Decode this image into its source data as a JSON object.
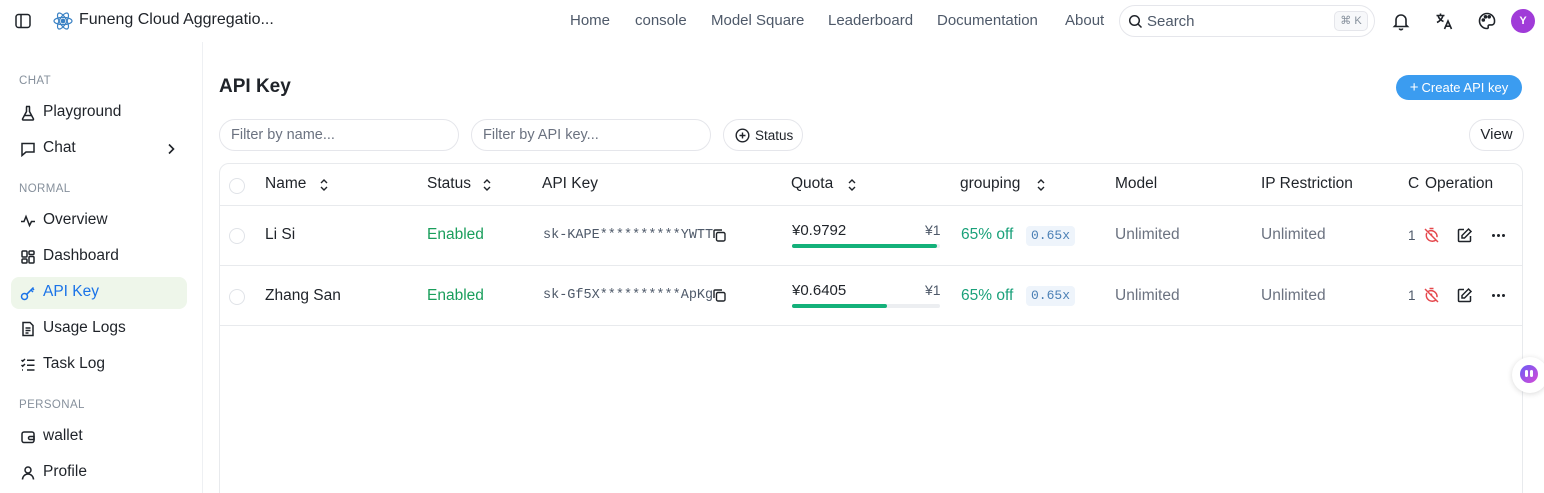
{
  "header": {
    "app_title": "Funeng Cloud Aggregatio...",
    "nav": [
      "Home",
      "console",
      "Model Square",
      "Leaderboard",
      "Documentation",
      "About"
    ],
    "search_placeholder": "Search",
    "search_shortcut": "⌘ K",
    "avatar_initial": "Y"
  },
  "sidebar": {
    "sections": [
      {
        "label": "CHAT",
        "items": [
          {
            "label": "Playground",
            "icon": "flask-icon"
          },
          {
            "label": "Chat",
            "icon": "chat-bubble-icon",
            "has_chevron": true
          }
        ]
      },
      {
        "label": "NORMAL",
        "items": [
          {
            "label": "Overview",
            "icon": "activity-icon"
          },
          {
            "label": "Dashboard",
            "icon": "grid-icon"
          },
          {
            "label": "API Key",
            "icon": "key-icon",
            "active": true
          },
          {
            "label": "Usage Logs",
            "icon": "document-icon"
          },
          {
            "label": "Task Log",
            "icon": "task-list-icon"
          }
        ]
      },
      {
        "label": "PERSONAL",
        "items": [
          {
            "label": "wallet",
            "icon": "wallet-icon"
          },
          {
            "label": "Profile",
            "icon": "user-icon"
          }
        ]
      }
    ]
  },
  "main": {
    "title": "API Key",
    "create_button": "Create API key",
    "filter_name_placeholder": "Filter by name...",
    "filter_key_placeholder": "Filter by API key...",
    "status_filter": "Status",
    "view_button": "View",
    "table": {
      "columns": [
        "Name",
        "Status",
        "API Key",
        "Quota",
        "grouping",
        "Model",
        "IP Restriction",
        "C",
        "Operation"
      ],
      "rows": [
        {
          "name": "Li Si",
          "status": "Enabled",
          "api_key": "sk-KAPE**********YWTT",
          "quota_used": "¥0.9792",
          "quota_total": "¥1",
          "quota_fraction": 0.98,
          "group_discount": "65% off",
          "group_ratio": "0.65x",
          "model": "Unlimited",
          "ip_restriction": "Unlimited",
          "c_value": "1"
        },
        {
          "name": "Zhang San",
          "status": "Enabled",
          "api_key": "sk-Gf5X**********ApKg",
          "quota_used": "¥0.6405",
          "quota_total": "¥1",
          "quota_fraction": 0.64,
          "group_discount": "65% off",
          "group_ratio": "0.65x",
          "model": "Unlimited",
          "ip_restriction": "Unlimited",
          "c_value": "1"
        }
      ]
    }
  },
  "colors": {
    "accent": "#3b9cf0",
    "status_enabled": "#1a9e5c",
    "quota_fill": "#14b17a",
    "active_bg": "#eef6ea",
    "danger": "#e5484d"
  }
}
